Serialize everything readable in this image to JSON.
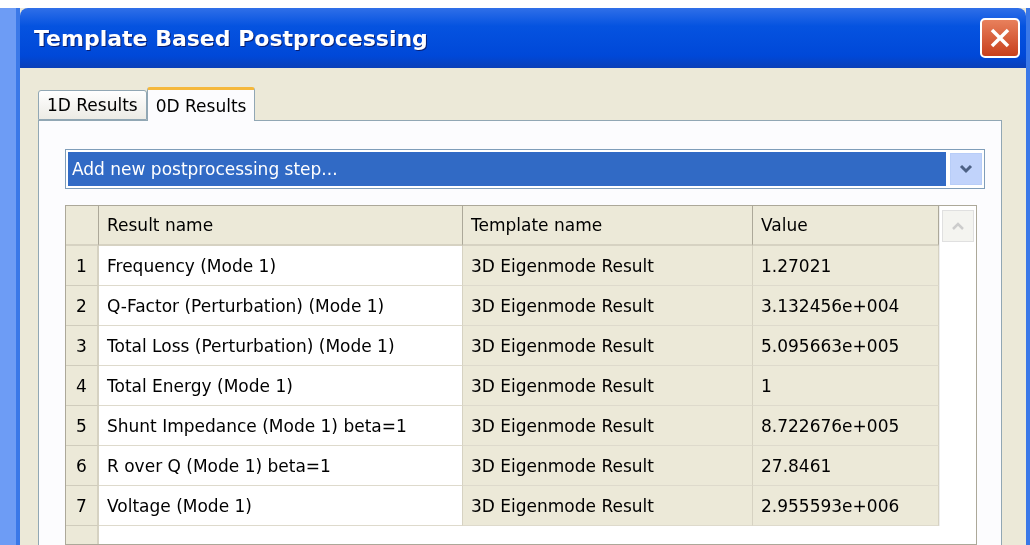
{
  "window": {
    "title": "Template Based Postprocessing"
  },
  "tabs": [
    {
      "label": "1D Results",
      "selected": false
    },
    {
      "label": "0D Results",
      "selected": true
    }
  ],
  "dropdown": {
    "value": "Add new postprocessing step..."
  },
  "table": {
    "columns": [
      "Result name",
      "Template name",
      "Value"
    ],
    "rows": [
      {
        "index": "1",
        "result_name": "Frequency (Mode 1)",
        "template_name": "3D Eigenmode Result",
        "value": "1.27021"
      },
      {
        "index": "2",
        "result_name": "Q-Factor (Perturbation) (Mode 1)",
        "template_name": "3D Eigenmode Result",
        "value": "3.132456e+004"
      },
      {
        "index": "3",
        "result_name": "Total Loss (Perturbation) (Mode 1)",
        "template_name": "3D Eigenmode Result",
        "value": "5.095663e+005"
      },
      {
        "index": "4",
        "result_name": "Total Energy (Mode 1)",
        "template_name": "3D Eigenmode Result",
        "value": "1"
      },
      {
        "index": "5",
        "result_name": "Shunt Impedance (Mode 1) beta=1",
        "template_name": "3D Eigenmode Result",
        "value": "8.722676e+005"
      },
      {
        "index": "6",
        "result_name": "R over Q (Mode 1) beta=1",
        "template_name": "3D Eigenmode Result",
        "value": "27.8461"
      },
      {
        "index": "7",
        "result_name": "Voltage (Mode 1)",
        "template_name": "3D Eigenmode Result",
        "value": "2.955593e+006"
      }
    ]
  }
}
